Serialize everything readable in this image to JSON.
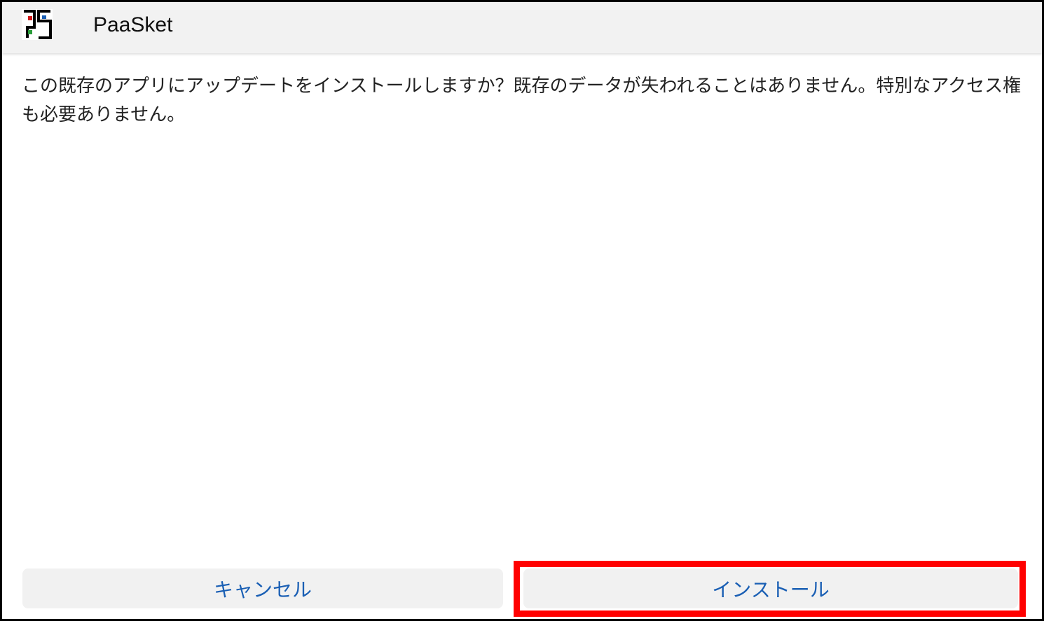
{
  "header": {
    "app_name": "PaaSket",
    "app_icon": "paasket-logo-icon"
  },
  "dialog": {
    "message": "この既存のアプリにアップデートをインストールしますか？既存のデータが失われることはありません。特別なアクセス権も必要ありません。"
  },
  "buttons": {
    "cancel_label": "キャンセル",
    "install_label": "インストール"
  },
  "colors": {
    "accent": "#1a5fb4",
    "highlight": "#ff0000",
    "header_bg": "#f2f2f2",
    "button_bg": "#f1f1f1"
  }
}
